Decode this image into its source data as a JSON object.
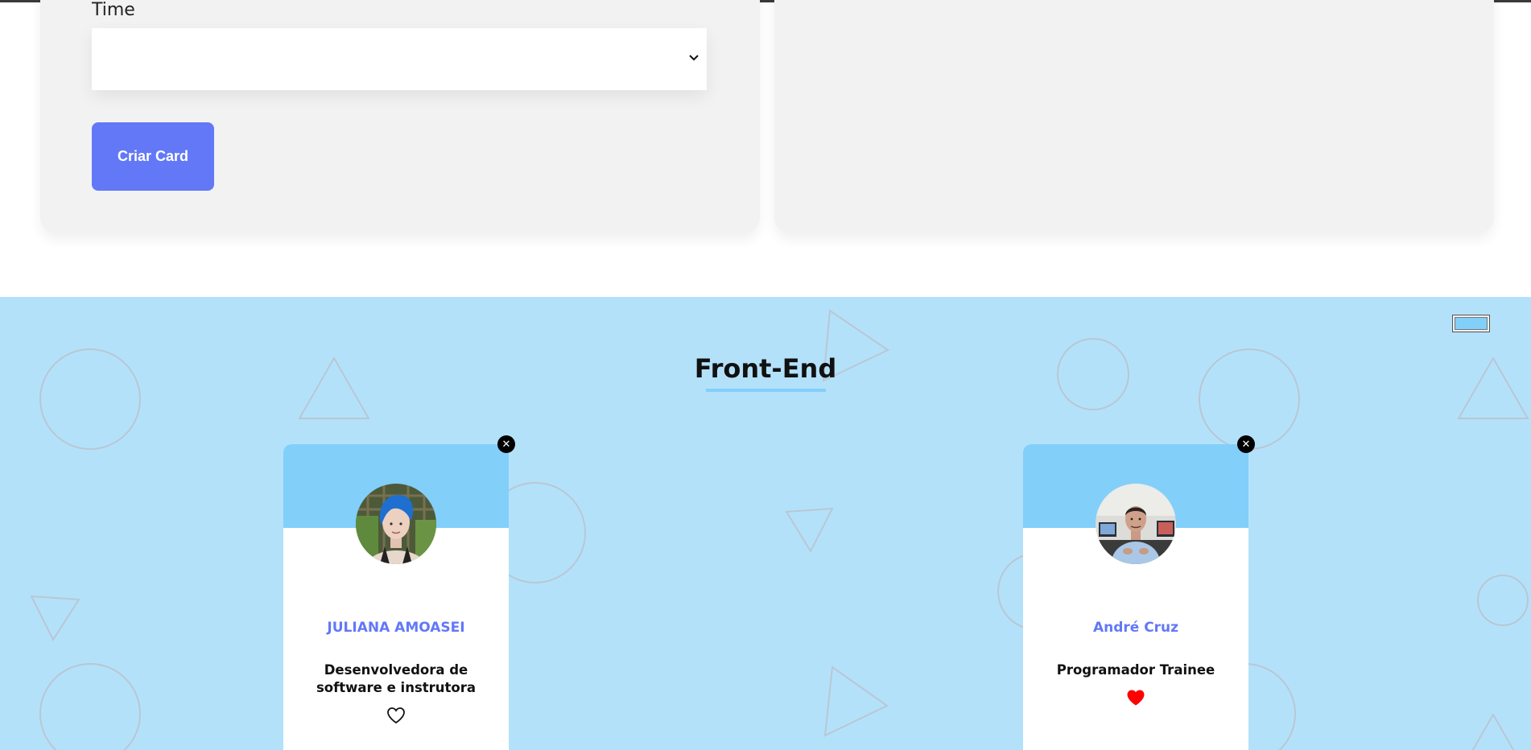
{
  "form": {
    "time_label": "Time",
    "time_value": "",
    "create_button": "Criar Card"
  },
  "team": {
    "title": "Front-End",
    "primary_color": "#82cffa",
    "secondary_color": "#b4e1fa",
    "members": [
      {
        "name": "JULIANA AMOASEI",
        "role": "Desenvolvedora de software e instrutora",
        "favorite": false
      },
      {
        "name": "André Cruz",
        "role": "Programador Trainee",
        "favorite": true
      }
    ]
  },
  "colors": {
    "accent": "#6278f7",
    "favorite_heart": "#ff0000",
    "panel_bg": "#f2f2f2"
  }
}
